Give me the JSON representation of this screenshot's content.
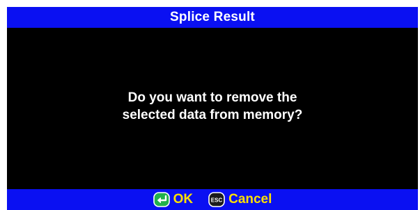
{
  "dialog": {
    "title": "Splice Result",
    "message_line1": "Do you want to remove the",
    "message_line2": "selected data from memory?"
  },
  "buttons": {
    "ok": {
      "label": "OK",
      "icon": "enter-key-icon"
    },
    "cancel": {
      "label": "Cancel",
      "icon": "esc-key-icon",
      "icon_text": "ESC"
    }
  },
  "colors": {
    "bar": "#0a10f2",
    "background": "#000000",
    "text": "#ffffff",
    "button_label": "#ffe100",
    "enter_key": "#22b14c"
  }
}
